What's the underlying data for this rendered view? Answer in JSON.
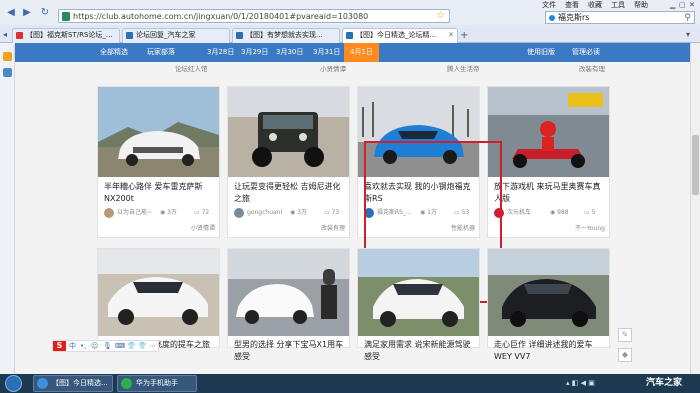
{
  "browser": {
    "url": "https://club.autohome.com.cn/jingxuan/0/1/20180401#pvareaid=103080",
    "menu": [
      "文件",
      "查看",
      "收藏",
      "工具",
      "帮助"
    ],
    "search_query": "福克斯rs",
    "tabs": [
      {
        "label": "【图】福克斯ST/RS论坛_..."
      },
      {
        "label": "论坛回复_汽车之家"
      },
      {
        "label": "【图】有梦想就去实现..."
      },
      {
        "label": "【图】今日精选_论坛精..."
      }
    ]
  },
  "site_nav": {
    "items": [
      "全部精选",
      "玩家部落",
      "3月28日",
      "3月29日",
      "3月30日",
      "3月31日",
      "4月1日",
      "使用旧版",
      "管理必读"
    ],
    "active_index": 6
  },
  "section_captions": [
    "论坛红人馆",
    "小贤情谭",
    "腾人生活帝",
    "改装有理"
  ],
  "cards_row1": [
    {
      "title": "半年糟心路伴 爱车雷克萨斯NX200t",
      "user": "以为自己能~",
      "views": "3万",
      "comments": "72",
      "tag": "小贤情谭"
    },
    {
      "title": "让玩耍变得更轻松 吉姆尼进化之旅",
      "user": "gongchuanl",
      "views": "3万",
      "comments": "73",
      "tag": "改装有理"
    },
    {
      "title": "喜欢就去实现 我的小钢炮福克斯RS",
      "user": "福克斯RS_...",
      "views": "1万",
      "comments": "53",
      "tag": "性能机器"
    },
    {
      "title": "放下游戏机 来玩马里奥赛车真人版",
      "user": "次元机车",
      "views": "988",
      "comments": "5",
      "tag": "不一Young"
    }
  ],
  "cards_row2": [
    {
      "title": "聊飞度的提车之旅"
    },
    {
      "title": "型男的选择 分享下宝马X1用车感受"
    },
    {
      "title": "满足家用需求 说宋新能源驾驶感受"
    },
    {
      "title": "走心巨作 详细讲述我的爱车WEY VV7"
    }
  ],
  "ime": {
    "label": "S",
    "glyphs": [
      "中",
      "•,",
      "☺",
      "🎙",
      "⌨",
      "👕",
      "👕",
      "⋯"
    ]
  },
  "taskbar": {
    "items": [
      {
        "label": "【图】今日精选..."
      },
      {
        "label": "华为手机助手"
      }
    ],
    "watermark": "汽车之家"
  },
  "colors": {
    "nav_bg": "#3a79c4",
    "nav_active": "#ff8a1f",
    "highlight_border": "#d0202a"
  }
}
